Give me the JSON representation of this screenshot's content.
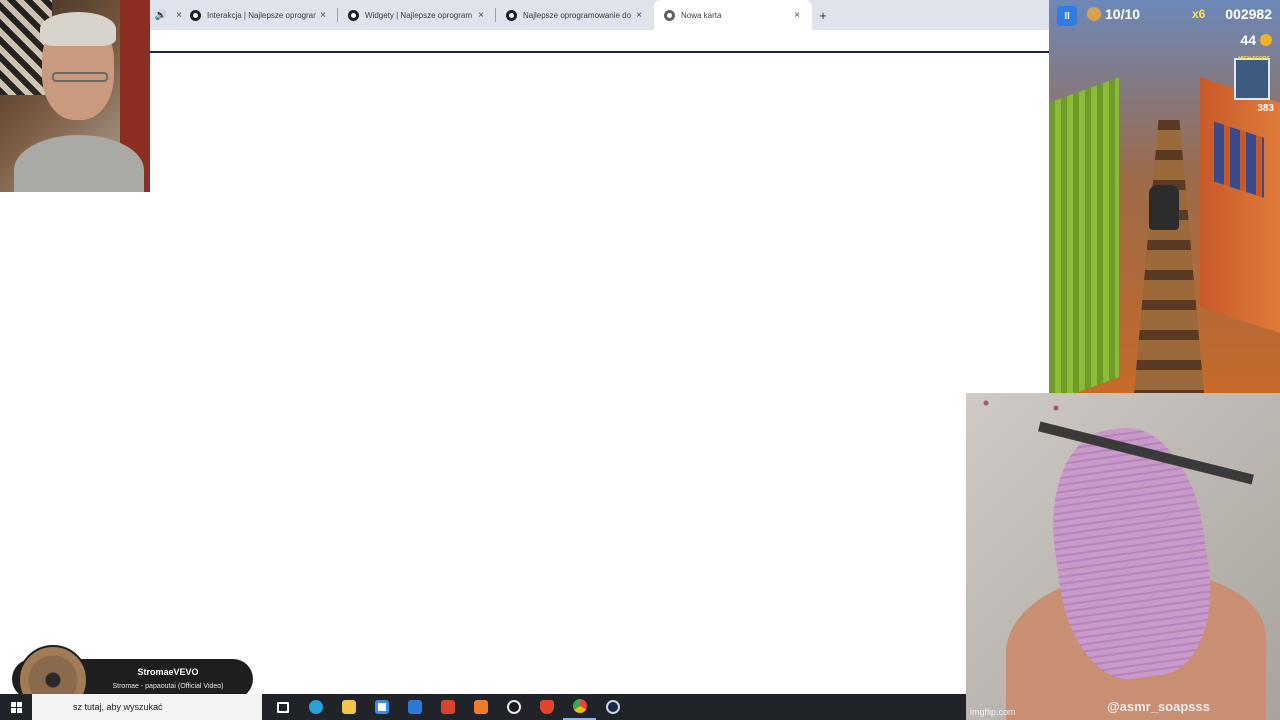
{
  "browser": {
    "tabs": [
      {
        "label": "Interakcja | Najlepsze oprogram",
        "close": "×"
      },
      {
        "label": "Widgety | Najlepsze oprogram",
        "close": "×"
      },
      {
        "label": "Najlepsze oprogramowanie do",
        "close": "×"
      },
      {
        "label": "Nowa karta",
        "close": "×",
        "active": true
      }
    ],
    "audio_icon": "🔊",
    "first_tab_close": "×",
    "new_tab": "+"
  },
  "game": {
    "pause": "II",
    "lives": "10/10",
    "multiplier": "x6",
    "score": "002982",
    "coins": "44",
    "highscore_label": "HIGH SCORE",
    "highscore_value": "383"
  },
  "soap_video": {
    "watermark_left": "imgflip.com",
    "watermark_right": "@asmr_soapsss"
  },
  "music_notification": {
    "title": "StromaeVEVO",
    "subtitle": "Stromae - papaoutai (Official Video)"
  },
  "taskbar": {
    "search_text": "sz tutaj, aby wyszukać",
    "apps": [
      {
        "name": "task-view",
        "color": "#ffffff"
      },
      {
        "name": "edge",
        "color": "#2aa0d8"
      },
      {
        "name": "file-explorer",
        "color": "#f2c24a"
      },
      {
        "name": "store",
        "color": "#3a8ee6"
      },
      {
        "name": "mail",
        "color": "#2b79d6"
      },
      {
        "name": "office",
        "color": "#d9432b"
      },
      {
        "name": "xampp",
        "color": "#f07b2a"
      },
      {
        "name": "obs",
        "color": "#e8e8e8"
      },
      {
        "name": "brave",
        "color": "#e2452a"
      },
      {
        "name": "chrome",
        "color": "#4caf50",
        "active": true
      },
      {
        "name": "steam",
        "color": "#1b2a4a"
      }
    ]
  }
}
